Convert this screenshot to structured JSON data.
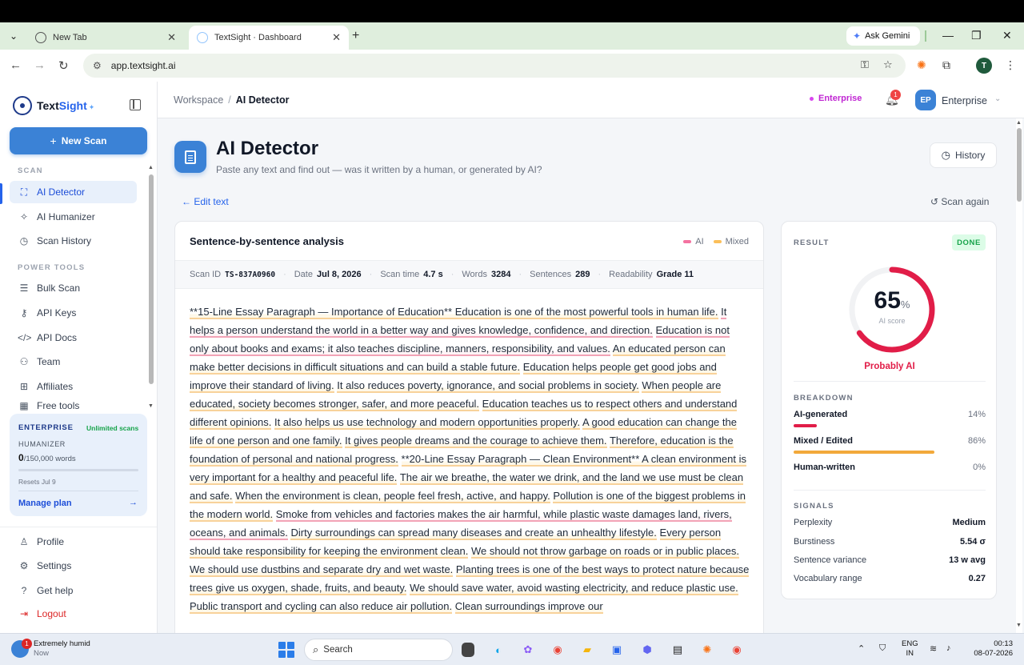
{
  "browser": {
    "tabs": [
      {
        "title": "New Tab",
        "close": "✕"
      },
      {
        "title": "TextSight · Dashboard",
        "close": "✕"
      }
    ],
    "new_tab": "+",
    "gemini": "Ask Gemini",
    "url": "app.textsight.ai",
    "profile_initial": "T"
  },
  "sidebar": {
    "brand_a": "Text",
    "brand_b": "Sight",
    "new_scan": "New Scan",
    "section_scan": "SCAN",
    "scan_items": [
      {
        "label": "AI Detector",
        "icon": "scan-icon"
      },
      {
        "label": "AI Humanizer",
        "icon": "sparkle-icon"
      },
      {
        "label": "Scan History",
        "icon": "clock-icon"
      }
    ],
    "section_power": "POWER TOOLS",
    "power_items": [
      {
        "label": "Bulk Scan",
        "icon": "layers-icon"
      },
      {
        "label": "API Keys",
        "icon": "key-icon"
      },
      {
        "label": "API Docs",
        "icon": "code-icon"
      },
      {
        "label": "Team",
        "icon": "users-icon"
      },
      {
        "label": "Affiliates",
        "icon": "gift-icon"
      },
      {
        "label": "Free tools",
        "icon": "grid-icon"
      }
    ],
    "plan": {
      "title": "ENTERPRISE",
      "badge": "Unlimited scans",
      "sub": "HUMANIZER",
      "used": "0",
      "total": "/150,000 words",
      "used_fraction": 0,
      "reset": "Resets Jul 9",
      "manage": "Manage plan"
    },
    "bottom_items": [
      {
        "label": "Profile",
        "icon": "user-icon"
      },
      {
        "label": "Settings",
        "icon": "gear-icon"
      },
      {
        "label": "Get help",
        "icon": "help-icon"
      },
      {
        "label": "Logout",
        "icon": "logout-icon"
      }
    ]
  },
  "header": {
    "crumb_root": "Workspace",
    "crumb_current": "AI Detector",
    "plan_pill": "Enterprise",
    "notif_count": "1",
    "avatar": "EP",
    "account": "Enterprise"
  },
  "page": {
    "title": "AI Detector",
    "subtitle": "Paste any text and find out — was it written by a human, or generated by AI?",
    "history": "History",
    "edit_text": "Edit text",
    "scan_again": "Scan again"
  },
  "analysis": {
    "title": "Sentence-by-sentence analysis",
    "legend_ai": "AI",
    "legend_mixed": "Mixed",
    "colors": {
      "ai": "#f2a3b6",
      "mixed": "#f8d29a"
    },
    "meta": [
      {
        "label": "Scan ID",
        "value": "TS-837A0960"
      },
      {
        "label": "Date",
        "value": "Jul 8, 2026"
      },
      {
        "label": "Scan time",
        "value": "4.7 s"
      },
      {
        "label": "Words",
        "value": "3284"
      },
      {
        "label": "Sentences",
        "value": "289"
      },
      {
        "label": "Readability",
        "value": "Grade 11"
      }
    ],
    "sentences": [
      {
        "t": "**15-Line Essay Paragraph — Importance of Education** Education is one of the most powerful tools in human life.",
        "k": "mx"
      },
      {
        "t": "It helps a person understand the world in a better way and gives knowledge, confidence, and direction.",
        "k": "ai"
      },
      {
        "t": "Education is not only about books and exams; it also teaches discipline, manners, responsibility, and values.",
        "k": "ai"
      },
      {
        "t": "An educated person can make better decisions in difficult situations and can build a stable future.",
        "k": "mx"
      },
      {
        "t": "Education helps people get good jobs and improve their standard of living.",
        "k": "mx"
      },
      {
        "t": "It also reduces poverty, ignorance, and social problems in society.",
        "k": "mx"
      },
      {
        "t": "When people are educated, society becomes stronger, safer, and more peaceful.",
        "k": "mx"
      },
      {
        "t": "Education teaches us to respect others and understand different opinions.",
        "k": "mx"
      },
      {
        "t": "It also helps us use technology and modern opportunities properly.",
        "k": "mx"
      },
      {
        "t": "A good education can change the life of one person and one family.",
        "k": "mx"
      },
      {
        "t": "It gives people dreams and the courage to achieve them.",
        "k": "mx"
      },
      {
        "t": "Therefore, education is the foundation of personal and national progress.",
        "k": "mx"
      },
      {
        "t": "**20-Line Essay Paragraph — Clean Environment** A clean environment is very important for a healthy and peaceful life.",
        "k": "mx"
      },
      {
        "t": "The air we breathe, the water we drink, and the land we use must be clean and safe.",
        "k": "mx"
      },
      {
        "t": "When the environment is clean, people feel fresh, active, and happy.",
        "k": "mx"
      },
      {
        "t": "Pollution is one of the biggest problems in the modern world.",
        "k": "mx"
      },
      {
        "t": "Smoke from vehicles and factories makes the air harmful, while plastic waste damages land, rivers, oceans, and animals.",
        "k": "ai"
      },
      {
        "t": "Dirty surroundings can spread many diseases and create an unhealthy lifestyle.",
        "k": "mx"
      },
      {
        "t": "Every person should take responsibility for keeping the environment clean.",
        "k": "mx"
      },
      {
        "t": "We should not throw garbage on roads or in public places.",
        "k": "mx"
      },
      {
        "t": "We should use dustbins and separate dry and wet waste.",
        "k": "mx"
      },
      {
        "t": "Planting trees is one of the best ways to protect nature because trees give us oxygen, shade, fruits, and beauty.",
        "k": "mx"
      },
      {
        "t": "We should save water, avoid wasting electricity, and reduce plastic use.",
        "k": "mx"
      },
      {
        "t": "Public transport and cycling can also reduce air pollution.",
        "k": "mx"
      },
      {
        "t": "Clean surroundings improve our",
        "k": "mx"
      }
    ]
  },
  "result": {
    "label": "RESULT",
    "status": "DONE",
    "score": "65",
    "score_value": 65,
    "score_unit": "%",
    "score_caption": "AI score",
    "verdict": "Probably AI",
    "colors": {
      "score": "#e11d48",
      "track": "#f1f2f4"
    },
    "breakdown_label": "BREAKDOWN",
    "breakdown": [
      {
        "name": "AI-generated",
        "pct": "14%",
        "value": 14,
        "color": "#e11d48"
      },
      {
        "name": "Mixed / Edited",
        "pct": "86%",
        "value": 86,
        "color": "#f2a93b"
      },
      {
        "name": "Human-written",
        "pct": "0%",
        "value": 0,
        "color": "#16a34a"
      }
    ],
    "signals_label": "SIGNALS",
    "signals": [
      {
        "name": "Perplexity",
        "value": "Medium"
      },
      {
        "name": "Burstiness",
        "value": "5.54 σ"
      },
      {
        "name": "Sentence variance",
        "value": "13 w avg"
      },
      {
        "name": "Vocabulary range",
        "value": "0.27"
      }
    ]
  },
  "taskbar": {
    "weather_title": "Extremely humid",
    "weather_sub": "Now",
    "weather_badge": "1",
    "search": "Search",
    "lang1": "ENG",
    "lang2": "IN",
    "time": "00:13",
    "date": "08-07-2026"
  }
}
